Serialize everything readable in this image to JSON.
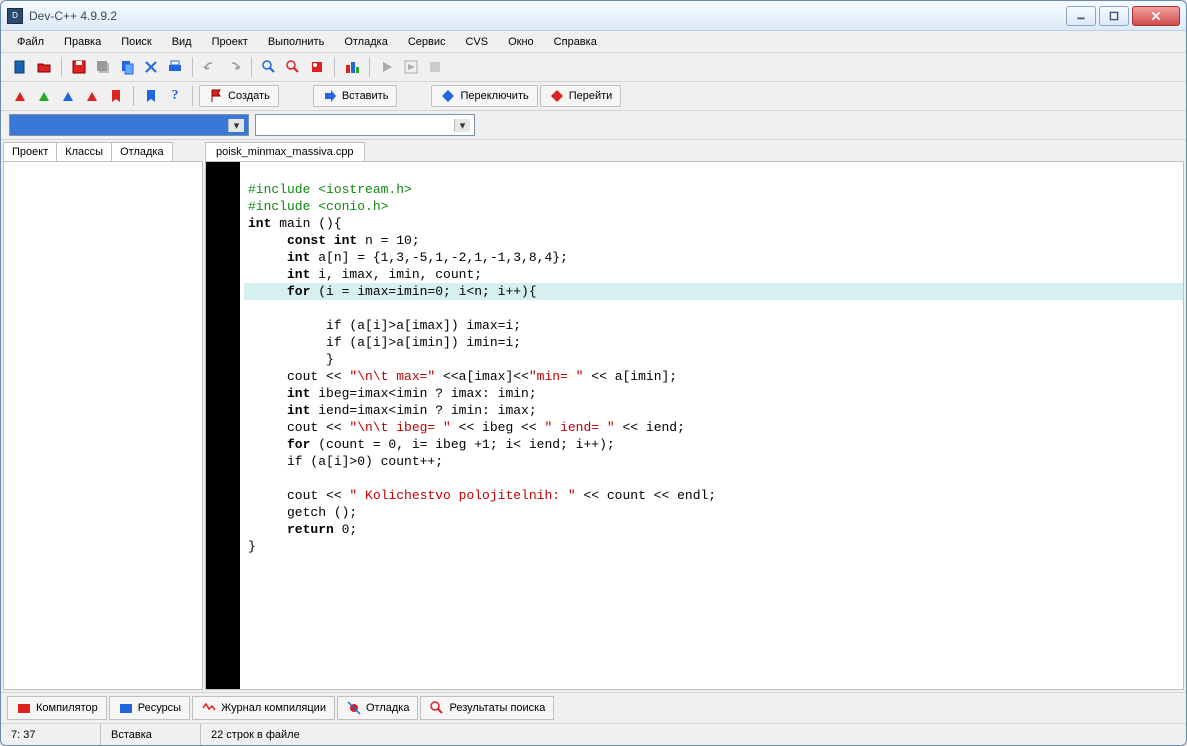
{
  "window": {
    "title": "Dev-C++ 4.9.9.2"
  },
  "menu": [
    "Файл",
    "Правка",
    "Поиск",
    "Вид",
    "Проект",
    "Выполнить",
    "Отладка",
    "Сервис",
    "CVS",
    "Окно",
    "Справка"
  ],
  "toolbar2": {
    "create": "Создать",
    "insert": "Вставить",
    "toggle": "Переключить",
    "goto": "Перейти"
  },
  "leftTabs": [
    "Проект",
    "Классы",
    "Отладка"
  ],
  "fileTab": "poisk_minmax_massiva.cpp",
  "code": {
    "l1": "#include <iostream.h>",
    "l2": "#include <conio.h>",
    "l3_a": "int",
    "l3_b": " main (){",
    "l4_a": "     const int",
    "l4_b": " n = 10;",
    "l5_a": "     int",
    "l5_b": " a[n] = {1,3,-5,1,-2,1,-1,3,8,4};",
    "l6_a": "     int",
    "l6_b": " i, imax, imin, count;",
    "l7_a": "     for",
    "l7_b": " (i = imax=imin=0; i<n; i++){",
    "l8": "          if (a[i]>a[imax]) imax=i;",
    "l9": "          if (a[i]>a[imin]) imin=i;",
    "l10": "          }",
    "l11_a": "     cout << ",
    "l11_s1": "\"\\n\\t max=\"",
    "l11_b": " <<a[imax]<<",
    "l11_s2": "\"min= \"",
    "l11_c": " << a[imin];",
    "l12_a": "     int",
    "l12_b": " ibeg=imax<imin ? imax: imin;",
    "l13_a": "     int",
    "l13_b": " iend=imax<imin ? imin: imax;",
    "l14_a": "     cout << ",
    "l14_s1": "\"\\n\\t ibeg= \"",
    "l14_b": " << ibeg << ",
    "l14_s2": "\" iend= \"",
    "l14_c": " << iend;",
    "l15_a": "     for",
    "l15_b": " (count = 0, i= ibeg +1; i< iend; i++);",
    "l16": "     if (a[i]>0) count++;",
    "l17": "",
    "l18_a": "     cout << ",
    "l18_s": "\" Kolichestvo polojitelnih: \"",
    "l18_b": " << count << endl;",
    "l19": "     getch ();",
    "l20_a": "     return",
    "l20_b": " 0;",
    "l21": "}"
  },
  "bottomTabs": [
    "Компилятор",
    "Ресурсы",
    "Журнал компиляции",
    "Отладка",
    "Результаты поиска"
  ],
  "status": {
    "pos": "7: 37",
    "mode": "Вставка",
    "lines": "22 строк в файле"
  }
}
